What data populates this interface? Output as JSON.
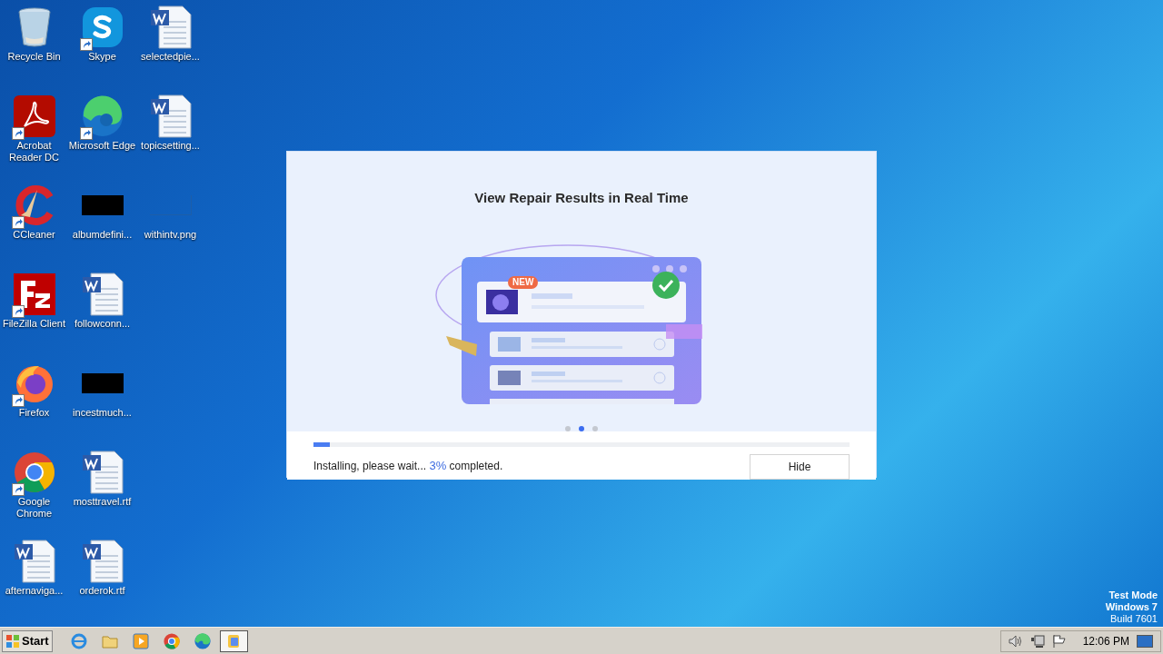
{
  "desktop_icons": [
    {
      "label": "Recycle Bin",
      "kind": "recycle-bin",
      "shortcut": false
    },
    {
      "label": "Acrobat Reader DC",
      "kind": "acrobat",
      "shortcut": true
    },
    {
      "label": "CCleaner",
      "kind": "ccleaner",
      "shortcut": true
    },
    {
      "label": "FileZilla Client",
      "kind": "filezilla",
      "shortcut": true
    },
    {
      "label": "Firefox",
      "kind": "firefox",
      "shortcut": true
    },
    {
      "label": "Google Chrome",
      "kind": "chrome",
      "shortcut": true
    },
    {
      "label": "afternaviga...",
      "kind": "document",
      "shortcut": false
    },
    {
      "label": "Skype",
      "kind": "skype",
      "shortcut": true
    },
    {
      "label": "Microsoft Edge",
      "kind": "edge",
      "shortcut": true
    },
    {
      "label": "albumdefini...",
      "kind": "image-dark",
      "shortcut": false
    },
    {
      "label": "followconn...",
      "kind": "document",
      "shortcut": false
    },
    {
      "label": "incestmuch...",
      "kind": "image-dark",
      "shortcut": false
    },
    {
      "label": "mosttravel.rtf",
      "kind": "document",
      "shortcut": false
    },
    {
      "label": "orderok.rtf",
      "kind": "document",
      "shortcut": false
    },
    {
      "label": "selectedpie...",
      "kind": "document",
      "shortcut": false
    },
    {
      "label": "topicsetting...",
      "kind": "document",
      "shortcut": false
    },
    {
      "label": "withintv.png",
      "kind": "image-blank",
      "shortcut": false
    }
  ],
  "dialog": {
    "title": "View Repair Results in Real Time",
    "badge": "NEW",
    "carousel_dots": [
      {
        "selected": false
      },
      {
        "selected": true
      },
      {
        "selected": false
      }
    ],
    "progress": {
      "level": 0.03
    },
    "status": {
      "prefix": "Installing, please wait... ",
      "percent": "3%",
      "suffix": " completed."
    },
    "button": "Hide"
  },
  "os_notice": [
    "Test Mode",
    "Windows 7",
    "Build 7601"
  ],
  "taskbar": {
    "start": "Start",
    "apps": [
      {
        "kind": "ie",
        "active": false
      },
      {
        "kind": "explorer",
        "active": false
      },
      {
        "kind": "media",
        "active": false
      },
      {
        "kind": "chrome",
        "active": false
      },
      {
        "kind": "edge",
        "active": false
      },
      {
        "kind": "installer",
        "active": true
      }
    ],
    "tray": [
      {
        "kind": "volume"
      },
      {
        "kind": "network"
      },
      {
        "kind": "flag"
      }
    ],
    "clock": "12:06 PM"
  }
}
